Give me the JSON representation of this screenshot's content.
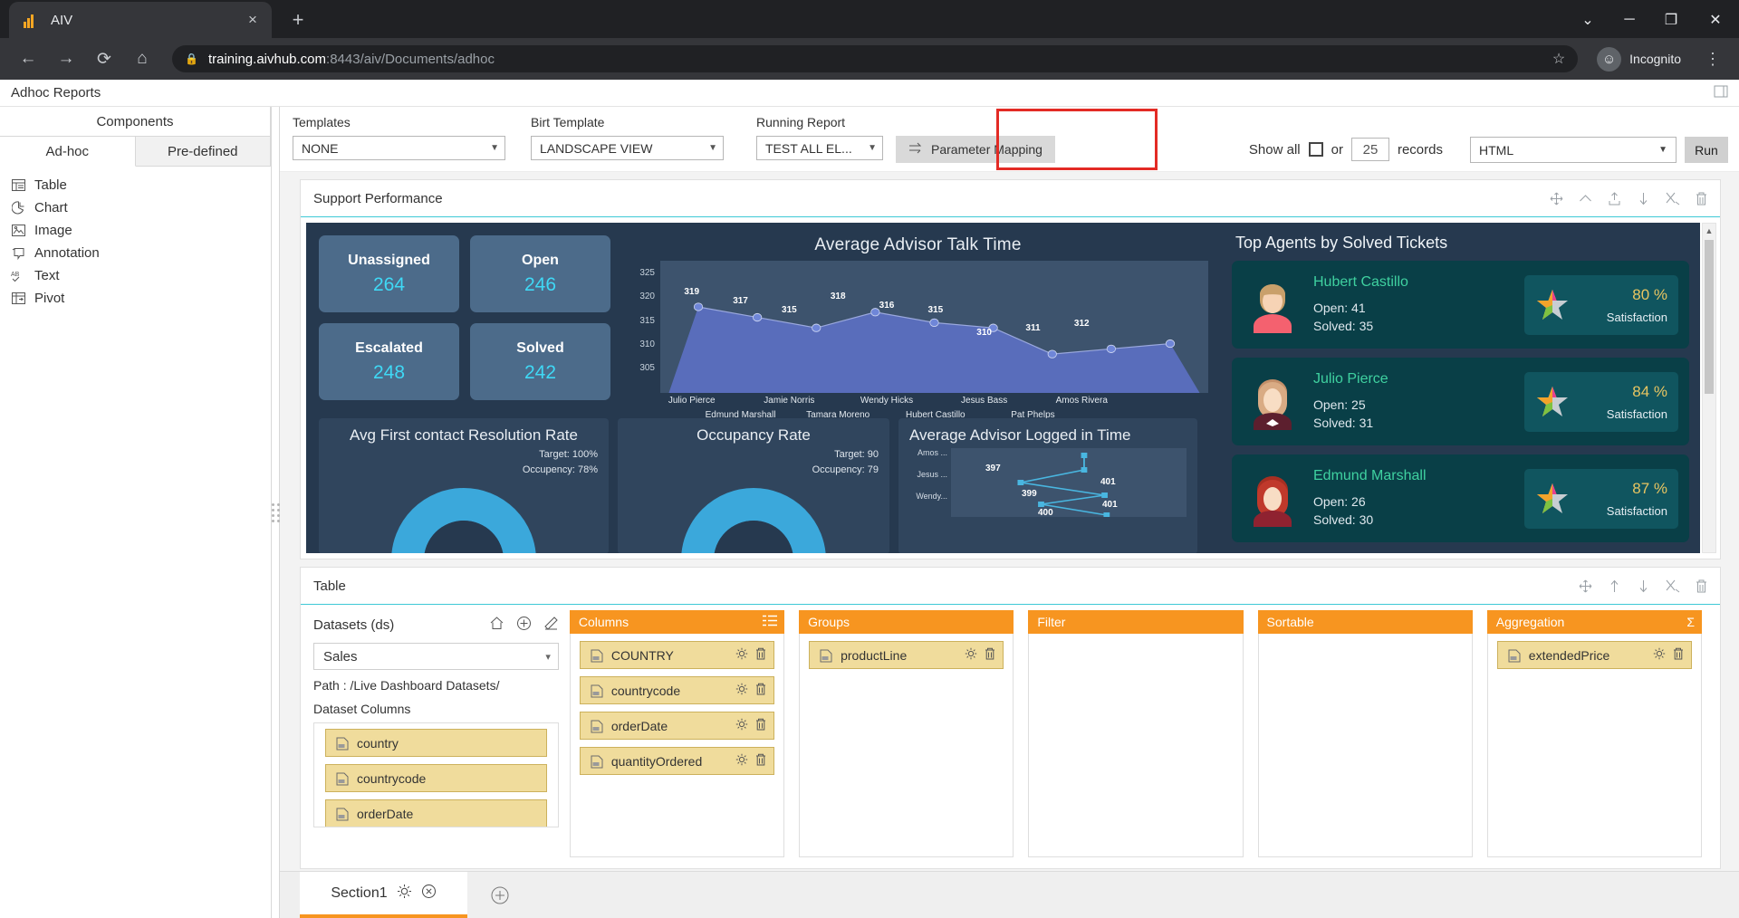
{
  "browser": {
    "tab_title": "AIV",
    "favicon": "bar-chart-icon",
    "close_label": "×",
    "newtab_label": "+",
    "url_host": "training.aivhub.com",
    "url_rest": ":8443/aiv/Documents/adhoc",
    "lock_icon": "🔒",
    "star_icon": "☆",
    "profile_label": "Incognito",
    "minimize_label": "─",
    "maximize_label": "❐",
    "window_close_label": "✕",
    "chevron_label": "⌄",
    "back_icon": "←",
    "forward_icon": "→",
    "reload_icon": "⟳",
    "home_icon": "⌂",
    "menu_icon": "⋮"
  },
  "app": {
    "title": "Adhoc Reports",
    "right_icon": "panel-toggle-icon"
  },
  "sidebar": {
    "header": "Components",
    "tabs": [
      {
        "label": "Ad-hoc",
        "active": true
      },
      {
        "label": "Pre-defined",
        "active": false
      }
    ],
    "items": [
      {
        "label": "Table",
        "icon": "table-icon"
      },
      {
        "label": "Chart",
        "icon": "pie-chart-icon"
      },
      {
        "label": "Image",
        "icon": "image-icon"
      },
      {
        "label": "Annotation",
        "icon": "annotation-icon"
      },
      {
        "label": "Text",
        "icon": "text-icon"
      },
      {
        "label": "Pivot",
        "icon": "pivot-icon"
      }
    ]
  },
  "toolbar": {
    "templates_label": "Templates",
    "templates_value": "NONE",
    "birt_label": "Birt Template",
    "birt_value": "LANDSCAPE VIEW",
    "running_label": "Running Report",
    "running_value": "TEST ALL EL...",
    "parameter_mapping": "Parameter Mapping",
    "parameter_mapping_icon": "swap-arrows-icon",
    "show_all_label": "Show all",
    "or_label": "or",
    "records_value": "25",
    "records_label": "records",
    "format_value": "HTML",
    "run_label": "Run",
    "highlight_color": "#e32b25",
    "caret": "▼"
  },
  "dashboard_widget": {
    "title": "Support Performance",
    "tools": [
      "move-icon",
      "collapse-up-icon",
      "export-icon",
      "move-down-icon",
      "settings-tools-icon",
      "delete-icon"
    ]
  },
  "dashboard": {
    "kpis": [
      {
        "label": "Unassigned",
        "value": "264"
      },
      {
        "label": "Open",
        "value": "246"
      },
      {
        "label": "Escalated",
        "value": "248"
      },
      {
        "label": "Solved",
        "value": "242"
      }
    ],
    "mini_cards": [
      {
        "title": "Avg First contact Resolution Rate",
        "line1": "Target: 100%",
        "line2": "Occupency: 78%",
        "percent": 78
      },
      {
        "title": "Occupancy Rate",
        "line1": "Target: 90",
        "line2": "Occupency: 79",
        "percent": 79
      }
    ],
    "logged_in": {
      "title": "Average Advisor Logged in Time",
      "categories": [
        "Amos ...",
        "Jesus ...",
        "Wendy..."
      ],
      "labels": [
        "397",
        "401",
        "399",
        "401",
        "400"
      ]
    },
    "agents_title": "Top Agents by Solved Tickets",
    "agents": [
      {
        "name": "Hubert Castillo",
        "open": "Open: 41",
        "solved": "Solved: 35",
        "satisfaction": "80 %",
        "sat_label": "Satisfaction",
        "shirt": "#f4616f",
        "hair": "#c9a06b"
      },
      {
        "name": "Julio Pierce",
        "open": "Open: 25",
        "solved": "Solved: 31",
        "satisfaction": "84 %",
        "sat_label": "Satisfaction",
        "shirt": "#5c1f2e",
        "hair": "#d9ab84"
      },
      {
        "name": "Edmund Marshall",
        "open": "Open: 26",
        "solved": "Solved: 30",
        "satisfaction": "87 %",
        "sat_label": "Satisfaction",
        "shirt": "#8f2230",
        "hair": "#c0392b"
      }
    ]
  },
  "chart_data": {
    "type": "area",
    "title": "Average Advisor Talk Time",
    "xlabel": "",
    "ylabel": "",
    "ylim": [
      303,
      327
    ],
    "yticks": [
      305,
      310,
      315,
      320,
      325
    ],
    "categories": [
      "Julio Pierce",
      "Edmund Marshall",
      "Jamie Norris",
      "Tamara Moreno",
      "Wendy Hicks",
      "Hubert Castillo",
      "Jesus Bass",
      "Pat Phelps",
      "Amos Rivera"
    ],
    "values": [
      319,
      317,
      315,
      318,
      316,
      315,
      310,
      311,
      312
    ],
    "grid": false,
    "legend": "none"
  },
  "table_widget": {
    "title": "Table",
    "tools": [
      "move-icon",
      "collapse-up-icon",
      "move-down-icon",
      "settings-tools-icon",
      "delete-icon"
    ]
  },
  "datasets": {
    "label": "Datasets (ds)",
    "tools": [
      "home-icon",
      "add-icon",
      "edit-icon"
    ],
    "selected": "Sales",
    "path_label": "Path :",
    "path_value": "/Live Dashboard Datasets/",
    "columns_label": "Dataset Columns",
    "columns": [
      "country",
      "countrycode",
      "orderDate"
    ]
  },
  "buckets": [
    {
      "name": "Columns",
      "icon": "list-icon",
      "items": [
        "COUNTRY",
        "countrycode",
        "orderDate",
        "quantityOrdered"
      ]
    },
    {
      "name": "Groups",
      "icon": "",
      "items": [
        "productLine"
      ]
    },
    {
      "name": "Filter",
      "icon": "",
      "items": []
    },
    {
      "name": "Sortable",
      "icon": "",
      "items": []
    },
    {
      "name": "Aggregation",
      "icon": "sigma-icon",
      "items": [
        "extendedPrice"
      ]
    }
  ],
  "sections": {
    "tab_label": "Section1",
    "gear_icon": "gear-icon",
    "close_icon": "close-circle-icon",
    "add_icon": "add-section-icon"
  }
}
